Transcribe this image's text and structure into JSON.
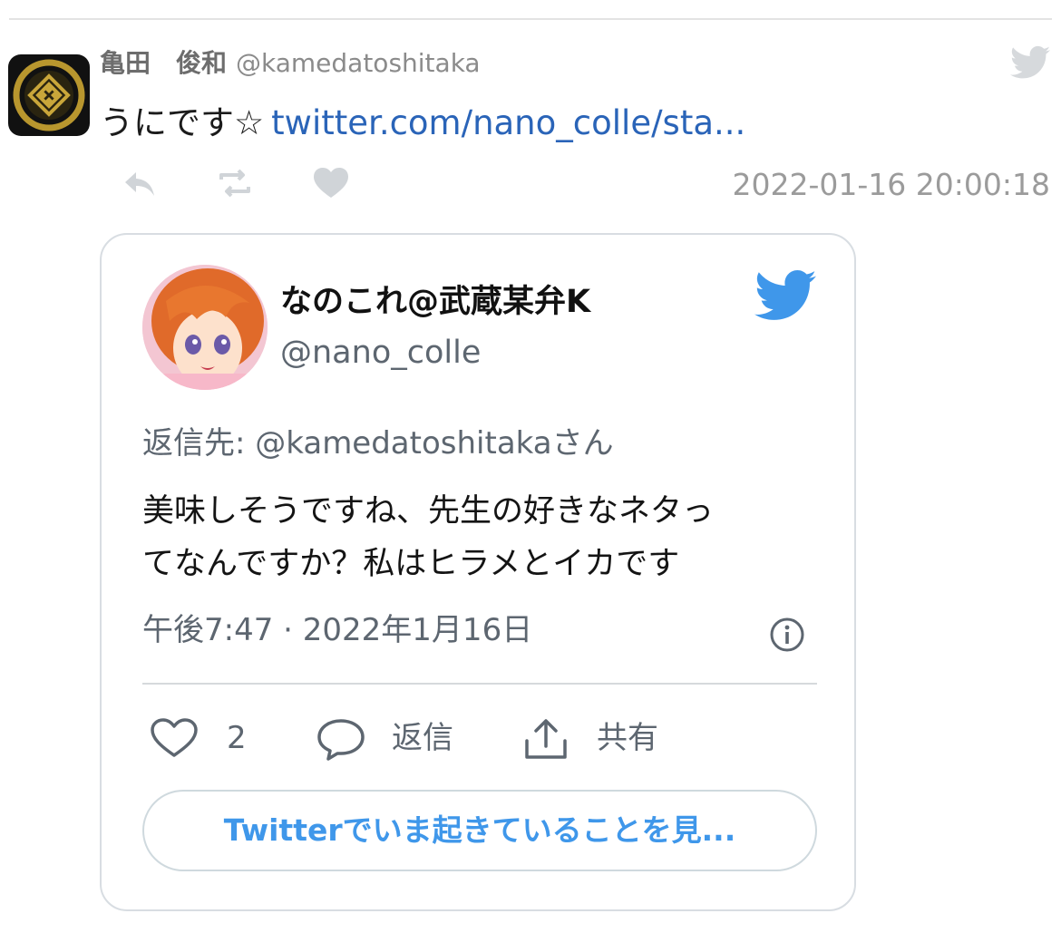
{
  "tweet": {
    "author_name": "亀田　俊和",
    "author_handle": "@kamedatoshitaka",
    "text": "うにです☆",
    "link_text": "twitter.com/nano_colle/sta...",
    "timestamp": "2022-01-16 20:00:18",
    "actions": [
      "reply-icon",
      "retweet-icon",
      "like-icon"
    ]
  },
  "embed": {
    "display_name": "なのこれ@武蔵某弁K",
    "handle": "@nano_colle",
    "reply_to": "返信先: @kamedatoshitakaさん",
    "body_line1": "美味しそうですね、先生の好きなネタっ",
    "body_line2": "てなんですか？私はヒラメとイカです",
    "time": "午後7:47 · 2022年1月16日",
    "like_count": "2",
    "reply_label": "返信",
    "share_label": "共有",
    "cta_label": "Twitterでいま起きていることを見..."
  },
  "colors": {
    "link": "#2a64b8",
    "twitter_blue": "#3f97ea",
    "muted_text": "#5d6670",
    "action_gray": "#c9cdd1"
  }
}
